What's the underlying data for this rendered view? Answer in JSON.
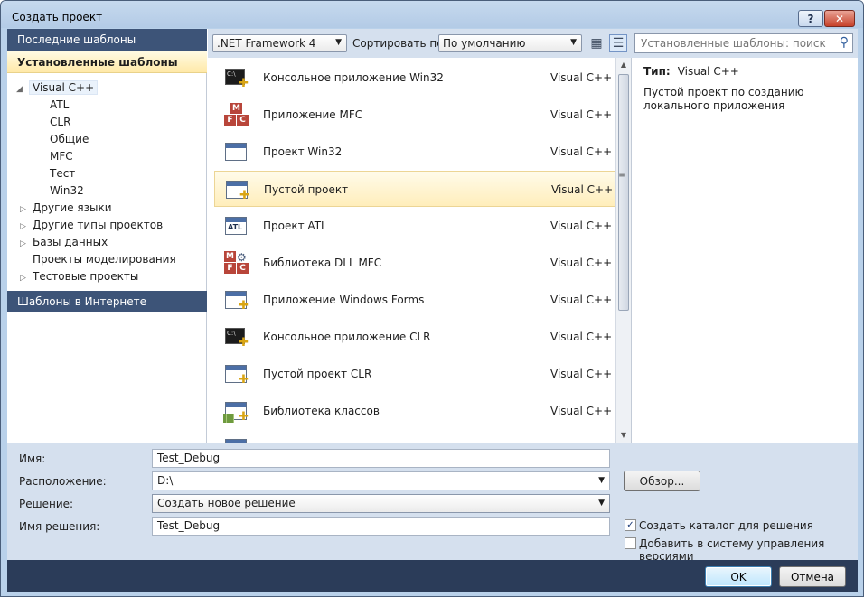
{
  "window": {
    "title": "Создать проект",
    "help_label": "?",
    "close_label": "✕"
  },
  "left_panel": {
    "recent_header": "Последние шаблоны",
    "installed_header": "Установленные шаблоны",
    "online_header": "Шаблоны в Интернете",
    "tree": {
      "visual_cpp": "Visual C++",
      "children": [
        "ATL",
        "CLR",
        "Общие",
        "MFC",
        "Тест",
        "Win32"
      ],
      "other_languages": "Другие языки",
      "other_project_types": "Другие типы проектов",
      "databases": "Базы данных",
      "modeling_projects": "Проекты моделирования",
      "test_projects": "Тестовые проекты"
    }
  },
  "toolbar": {
    "framework": ".NET Framework 4",
    "sort_label": "Сортировать по:",
    "sort_value": "По умолчанию",
    "search_placeholder": "Установленные шаблоны: поиск"
  },
  "templates": [
    {
      "name": "Консольное приложение Win32",
      "lang": "Visual C++",
      "icon": "console-icon"
    },
    {
      "name": "Приложение MFC",
      "lang": "Visual C++",
      "icon": "mfc-icon"
    },
    {
      "name": "Проект Win32",
      "lang": "Visual C++",
      "icon": "window-icon"
    },
    {
      "name": "Пустой проект",
      "lang": "Visual C++",
      "icon": "empty-project-icon",
      "selected": true
    },
    {
      "name": "Проект ATL",
      "lang": "Visual C++",
      "icon": "atl-icon"
    },
    {
      "name": "Библиотека DLL MFC",
      "lang": "Visual C++",
      "icon": "mfc-dll-icon"
    },
    {
      "name": "Приложение Windows Forms",
      "lang": "Visual C++",
      "icon": "windows-forms-icon"
    },
    {
      "name": "Консольное приложение CLR",
      "lang": "Visual C++",
      "icon": "clr-console-icon"
    },
    {
      "name": "Пустой проект CLR",
      "lang": "Visual C++",
      "icon": "clr-empty-icon"
    },
    {
      "name": "Библиотека классов",
      "lang": "Visual C++",
      "icon": "class-library-icon"
    }
  ],
  "details": {
    "type_label": "Тип:",
    "type_value": "Visual C++",
    "description": "Пустой проект по созданию локального приложения"
  },
  "form": {
    "name_label": "Имя:",
    "name_value": "Test_Debug",
    "location_label": "Расположение:",
    "location_value": "D:\\",
    "solution_label": "Решение:",
    "solution_value": "Создать новое решение",
    "solution_name_label": "Имя решения:",
    "solution_name_value": "Test_Debug",
    "browse_label": "Обзор...",
    "create_dir_label": "Создать каталог для решения",
    "create_dir_checked": true,
    "add_vcs_label": "Добавить в систему управления версиями",
    "add_vcs_checked": false
  },
  "buttons": {
    "ok": "OK",
    "cancel": "Отмена"
  }
}
